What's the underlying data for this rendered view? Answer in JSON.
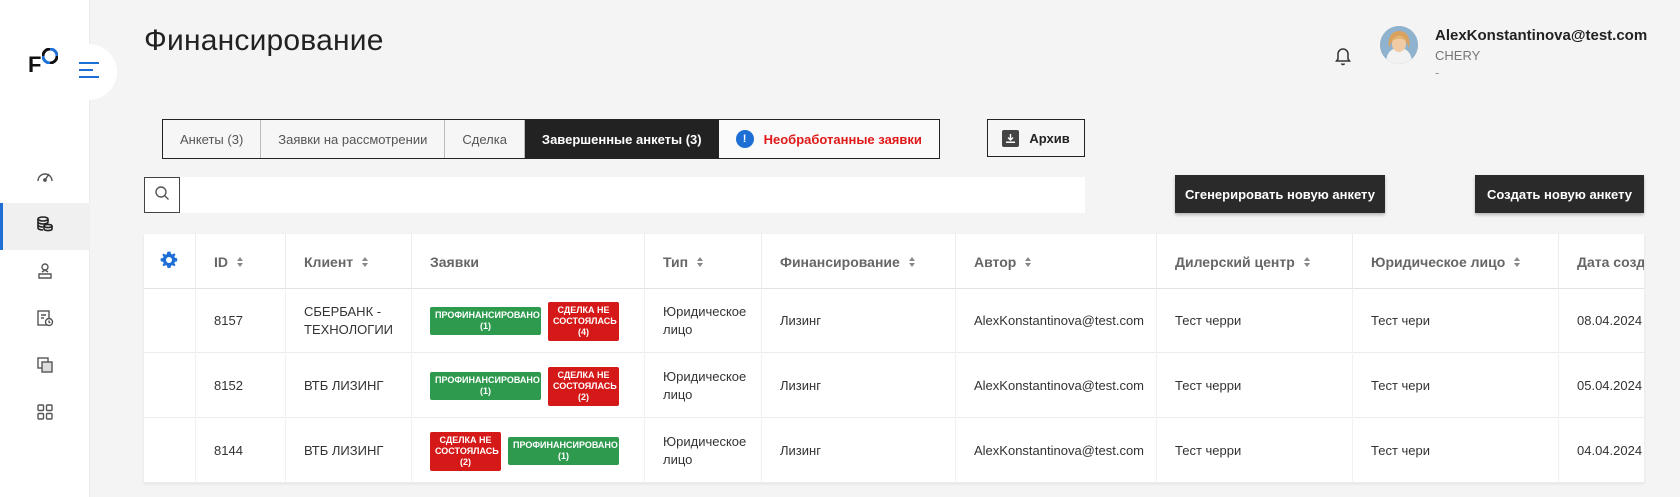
{
  "page": {
    "title": "Финансирование"
  },
  "user": {
    "email": "AlexKonstantinova@test.com",
    "company": "CHERY",
    "extra": "-"
  },
  "tabs": [
    {
      "label": "Анкеты (3)"
    },
    {
      "label": "Заявки на рассмотрении"
    },
    {
      "label": "Сделка"
    },
    {
      "label": "Завершенные анкеты (3)"
    },
    {
      "label": "Необработанные заявки"
    }
  ],
  "alert_tab": {
    "icon_glyph": "!"
  },
  "archive": {
    "label": "Архив"
  },
  "search": {
    "placeholder": "",
    "value": ""
  },
  "actions": {
    "generate_label": "Сгенерировать новую анкету",
    "create_label": "Создать новую анкету"
  },
  "table": {
    "headers": [
      "ID",
      "Клиент",
      "Заявки",
      "Тип",
      "Финансирование",
      "Автор",
      "Дилерский центр",
      "Юридическое лицо",
      "Дата создания"
    ],
    "rows": [
      {
        "id": "8157",
        "client": "СБЕРБАНК - ТЕХНОЛОГИИ",
        "badges": [
          {
            "text": "ПРОФИНАНСИРОВАНО (1)",
            "status": "green"
          },
          {
            "text": "СДЕЛКА НЕ СОСТОЯЛАСЬ (4)",
            "status": "red"
          }
        ],
        "type": "Юридическое лицо",
        "financing": "Лизинг",
        "author": "AlexKonstantinova@test.com",
        "dealer": "Тест черри",
        "legal": "Тест чери",
        "date": "08.04.2024"
      },
      {
        "id": "8152",
        "client": "ВТБ ЛИЗИНГ",
        "badges": [
          {
            "text": "ПРОФИНАНСИРОВАНО (1)",
            "status": "green"
          },
          {
            "text": "СДЕЛКА НЕ СОСТОЯЛАСЬ (2)",
            "status": "red"
          }
        ],
        "type": "Юридическое лицо",
        "financing": "Лизинг",
        "author": "AlexKonstantinova@test.com",
        "dealer": "Тест черри",
        "legal": "Тест чери",
        "date": "05.04.2024"
      },
      {
        "id": "8144",
        "client": "ВТБ ЛИЗИНГ",
        "badges": [
          {
            "text": "СДЕЛКА НЕ СОСТОЯЛАСЬ (2)",
            "status": "red"
          },
          {
            "text": "ПРОФИНАНСИРОВАНО (1)",
            "status": "green"
          }
        ],
        "type": "Юридическое лицо",
        "financing": "Лизинг",
        "author": "AlexKonstantinova@test.com",
        "dealer": "Тест черри",
        "legal": "Тест чери",
        "date": "04.04.2024"
      }
    ]
  },
  "colors": {
    "accent": "#1d6fd6",
    "dark": "#222222",
    "success": "#2e9a4e",
    "danger": "#d51818",
    "alert_text": "#e01919"
  },
  "icons": {
    "sidebar": [
      "speedometer-icon",
      "coins-stack-icon",
      "user-upload-icon",
      "document-clock-icon",
      "layers-icon",
      "grid-icon"
    ],
    "header": [
      "bell-icon"
    ],
    "table": [
      "settings-gear-icon"
    ]
  }
}
